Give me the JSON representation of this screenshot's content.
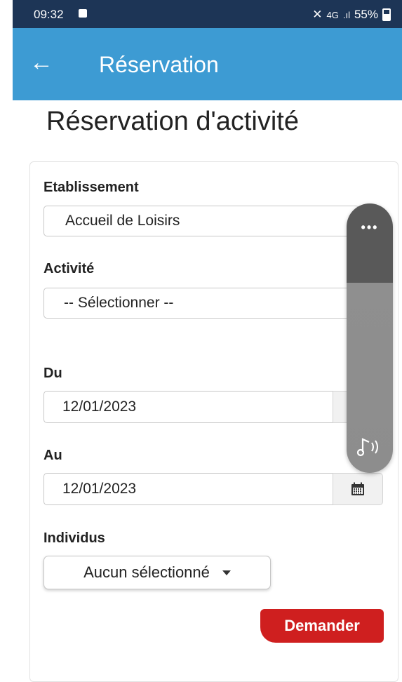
{
  "status_bar": {
    "time": "09:32",
    "network": "4G",
    "signal": ".ıl",
    "battery": "55%"
  },
  "app_bar": {
    "title": "Réservation"
  },
  "page": {
    "title": "Réservation d'activité"
  },
  "form": {
    "etablissement_label": "Etablissement",
    "etablissement_value": "Accueil de Loisirs",
    "activite_label": "Activité",
    "activite_value": "-- Sélectionner --",
    "du_label": "Du",
    "du_value": "12/01/2023",
    "au_label": "Au",
    "au_value": "12/01/2023",
    "individus_label": "Individus",
    "individus_value": "Aucun sélectionné",
    "submit_label": "Demander"
  },
  "icons": {
    "back": "arrow-left-icon",
    "calendar": "calendar-icon",
    "more": "more-dots-icon",
    "sound": "music-note-icon"
  },
  "colors": {
    "status_bar": "#1d3556",
    "app_bar": "#3d9bd3",
    "submit_button": "#cf1f1f"
  }
}
